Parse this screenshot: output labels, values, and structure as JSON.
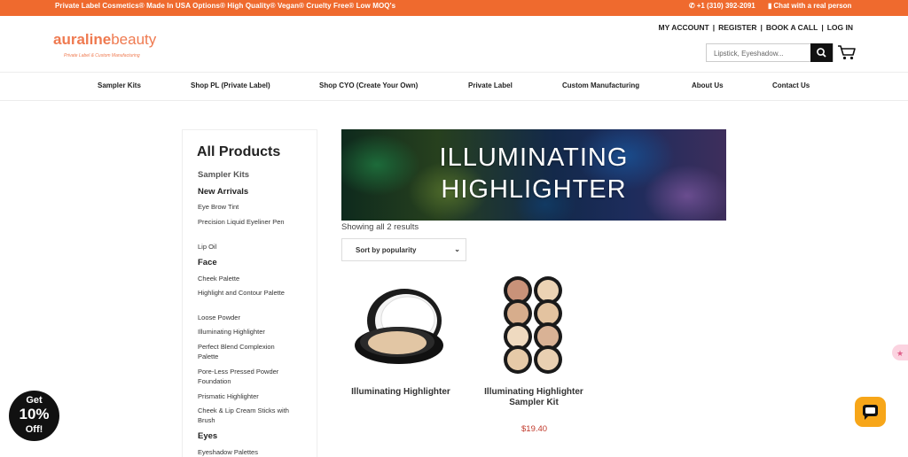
{
  "topbar": {
    "promo": "Private Label Cosmetics® Made In USA Options® High Quality® Vegan® Cruelty Free® Low MOQ's",
    "phone": "+1 (310) 392-2091",
    "chat": "Chat with a real person"
  },
  "logo": {
    "brand_bold": "auraline",
    "brand_light": "beauty",
    "tagline": "Private Label & Custom Manufacturing"
  },
  "account": {
    "my_account": "MY ACCOUNT",
    "register": "REGISTER",
    "book_call": "BOOK A CALL",
    "login": "LOG IN",
    "sep": "|"
  },
  "search": {
    "placeholder": "Lipstick, Eyeshadow..."
  },
  "nav": [
    "Sampler Kits",
    "Shop PL (Private Label)",
    "Shop CYO (Create Your Own)",
    "Private Label",
    "Custom Manufacturing",
    "About Us",
    "Contact Us"
  ],
  "sidebar": {
    "title": "All Products",
    "sampler": "Sampler Kits",
    "new_arrivals": "New Arrivals",
    "new_items": [
      "Eye Brow Tint",
      "Precision Liquid Eyeliner Pen",
      "Lip Oil"
    ],
    "face": "Face",
    "face_items": [
      "Cheek Palette",
      "Highlight and Contour Palette",
      "Loose Powder",
      "Illuminating Highlighter",
      "Perfect Blend Complexion Palette",
      "Pore-Less Pressed Powder Foundation",
      "Prismatic Highlighter",
      "Cheek & Lip Cream Sticks with Brush"
    ],
    "eyes": "Eyes",
    "eyes_cut": "Eyeshadow Palettes"
  },
  "banner": {
    "line1": "ILLUMINATING",
    "line2": "HIGHLIGHTER"
  },
  "results_text": "Showing all 2 results",
  "sort": {
    "selected": "Sort by popularity"
  },
  "products": [
    {
      "name": "Illuminating Highlighter"
    },
    {
      "name_l1": "Illuminating Highlighter",
      "name_l2": "Sampler Kit",
      "price": "$19.40"
    }
  ],
  "discount": {
    "l1": "Get",
    "l2": "10%",
    "l3": "Off!"
  },
  "colors": {
    "topbar": "#ef6a2e",
    "brand": "#ef7a50",
    "price": "#c0392b",
    "chat": "#f7a619"
  }
}
